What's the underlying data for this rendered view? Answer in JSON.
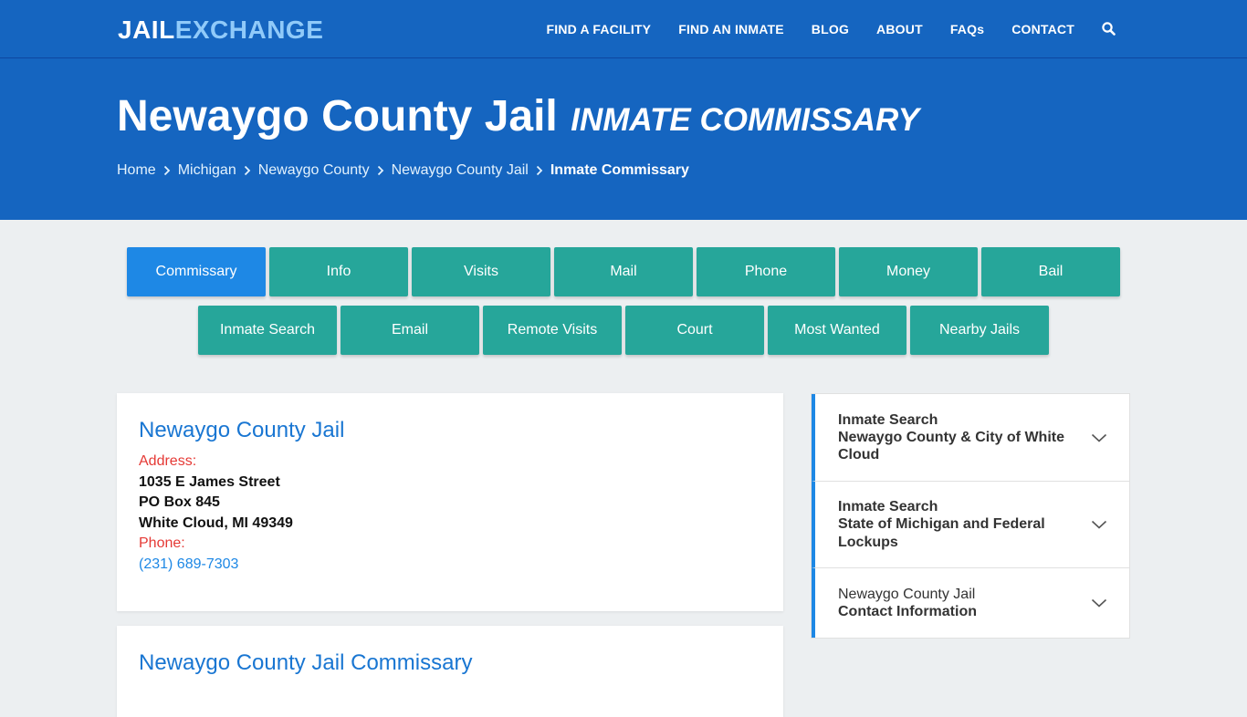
{
  "brand": {
    "part1": "JAIL",
    "part2": "EXCHANGE"
  },
  "nav": {
    "items": [
      "FIND A FACILITY",
      "FIND AN INMATE",
      "BLOG",
      "ABOUT",
      "FAQs",
      "CONTACT"
    ],
    "search_icon": "search-icon"
  },
  "hero": {
    "title": "Newaygo County Jail",
    "subtitle": "INMATE COMMISSARY"
  },
  "breadcrumb": [
    "Home",
    "Michigan",
    "Newaygo County",
    "Newaygo County Jail",
    "Inmate Commissary"
  ],
  "tabs": {
    "row1": [
      "Commissary",
      "Info",
      "Visits",
      "Mail",
      "Phone",
      "Money",
      "Bail"
    ],
    "row2": [
      "Inmate Search",
      "Email",
      "Remote Visits",
      "Court",
      "Most Wanted",
      "Nearby Jails"
    ],
    "active": "Commissary"
  },
  "facility": {
    "title": "Newaygo County Jail",
    "address_label": "Address:",
    "address_line1": "1035 E James Street",
    "address_line2": "PO Box 845",
    "address_line3": "White Cloud, MI 49349",
    "phone_label": "Phone:",
    "phone": "(231) 689-7303"
  },
  "commissary": {
    "title": "Newaygo County Jail Commissary"
  },
  "sidebar": {
    "items": [
      {
        "line1": "Inmate Search",
        "line2": "Newaygo County & City of White Cloud"
      },
      {
        "line1": "Inmate Search",
        "line2": "State of Michigan and Federal Lockups"
      },
      {
        "line1": "Newaygo County Jail",
        "line2": "Contact Information"
      }
    ]
  },
  "colors": {
    "header_blue": "#1565c0",
    "tab_teal": "#26a69a",
    "tab_active": "#1e88e5",
    "link_blue": "#1976d2",
    "label_red": "#e53935"
  }
}
